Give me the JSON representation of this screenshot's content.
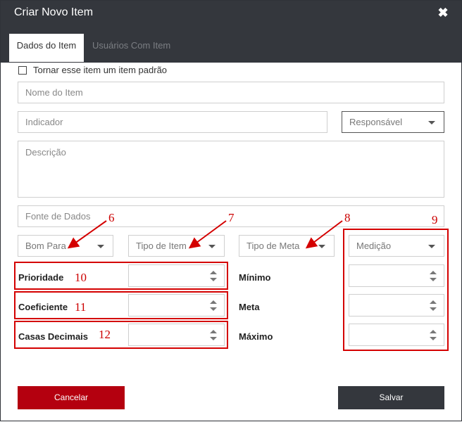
{
  "modal": {
    "title": "Criar Novo Item",
    "close_glyph": "✖"
  },
  "tabs": [
    {
      "label": "Dados do Item",
      "active": true
    },
    {
      "label": "Usuários Com Item",
      "active": false
    }
  ],
  "checkbox": {
    "label": "Tornar esse item um item padrão",
    "checked": false
  },
  "fields": {
    "nome_placeholder": "Nome do Item",
    "indicador_placeholder": "Indicador",
    "responsavel": "Responsável",
    "descricao_placeholder": "Descrição",
    "fonte_placeholder": "Fonte de Dados"
  },
  "selects": {
    "bom_para": "Bom Para",
    "tipo_item": "Tipo de Item",
    "tipo_meta": "Tipo de Meta",
    "medicao": "Medição"
  },
  "labels": {
    "prioridade": "Prioridade",
    "coeficiente": "Coeficiente",
    "casas_decimais": "Casas Decimais",
    "minimo": "Mínimo",
    "meta": "Meta",
    "maximo": "Máximo"
  },
  "annotations": {
    "n6": "6",
    "n7": "7",
    "n8": "8",
    "n9": "9",
    "n10": "10",
    "n11": "11",
    "n12": "12",
    "color": "#d40000"
  },
  "buttons": {
    "cancel": "Cancelar",
    "save": "Salvar"
  },
  "colors": {
    "header": "#34373d",
    "cancel": "#b4000f",
    "save": "#34373d"
  }
}
